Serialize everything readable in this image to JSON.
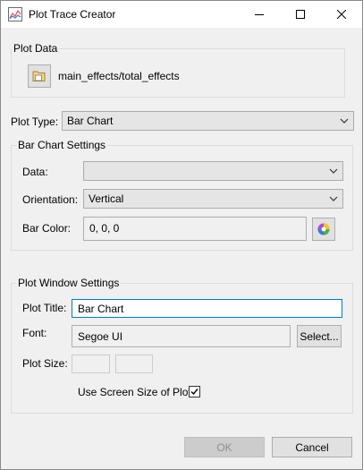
{
  "window": {
    "title": "Plot Trace Creator",
    "icons": {
      "app": "chart-icon",
      "minimize": "minimize-icon",
      "maximize": "maximize-icon",
      "close": "close-icon"
    }
  },
  "plot_data": {
    "group_label": "Plot Data",
    "path": "main_effects/total_effects",
    "browse_icon": "folder-icon"
  },
  "plot_type": {
    "label": "Plot Type:",
    "value": "Bar Chart"
  },
  "bar_chart_settings": {
    "group_label": "Bar Chart Settings",
    "data_label": "Data:",
    "data_value": "",
    "orientation_label": "Orientation:",
    "orientation_value": "Vertical",
    "bar_color_label": "Bar Color:",
    "bar_color_value": "0, 0, 0",
    "color_picker_icon": "color-wheel-icon"
  },
  "plot_window_settings": {
    "group_label": "Plot Window Settings",
    "plot_title_label": "Plot Title:",
    "plot_title_value": "Bar Chart",
    "font_label": "Font:",
    "font_value": "Segoe UI",
    "select_button": "Select...",
    "plot_size_label": "Plot Size:",
    "plot_size_width": "",
    "plot_size_height": "",
    "use_screen_size_label": "Use Screen Size of Plot:",
    "use_screen_size_checked": true
  },
  "footer": {
    "ok_label": "OK",
    "cancel_label": "Cancel"
  }
}
